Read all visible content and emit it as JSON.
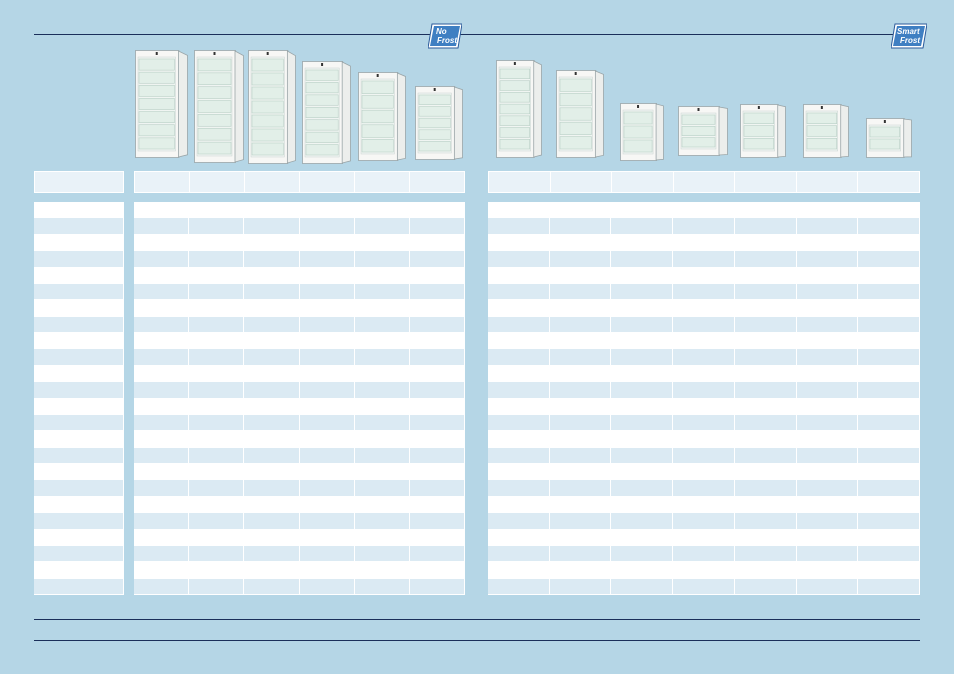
{
  "badges": {
    "no_frost": {
      "line1": "No",
      "line2": "Frost",
      "color": "#3f7fc2"
    },
    "smart_frost": {
      "line1": "Smart",
      "line2": "Frost",
      "color": "#3f7fc2"
    }
  },
  "colors": {
    "background": "#b5d6e6",
    "rule": "#1a2f5a",
    "row_light": "#ffffff",
    "row_tint": "#dbeaf3",
    "header_fill": "#e9f2f8"
  },
  "table": {
    "row_count": 24,
    "left_group_columns": 6,
    "right_group_columns": 7
  },
  "products": {
    "left_group": [
      "freezer-1",
      "freezer-2",
      "freezer-3",
      "freezer-4",
      "freezer-5",
      "freezer-6"
    ],
    "right_group": [
      "freezer-7",
      "freezer-8",
      "freezer-9",
      "freezer-10",
      "freezer-11",
      "freezer-12",
      "freezer-13"
    ]
  }
}
